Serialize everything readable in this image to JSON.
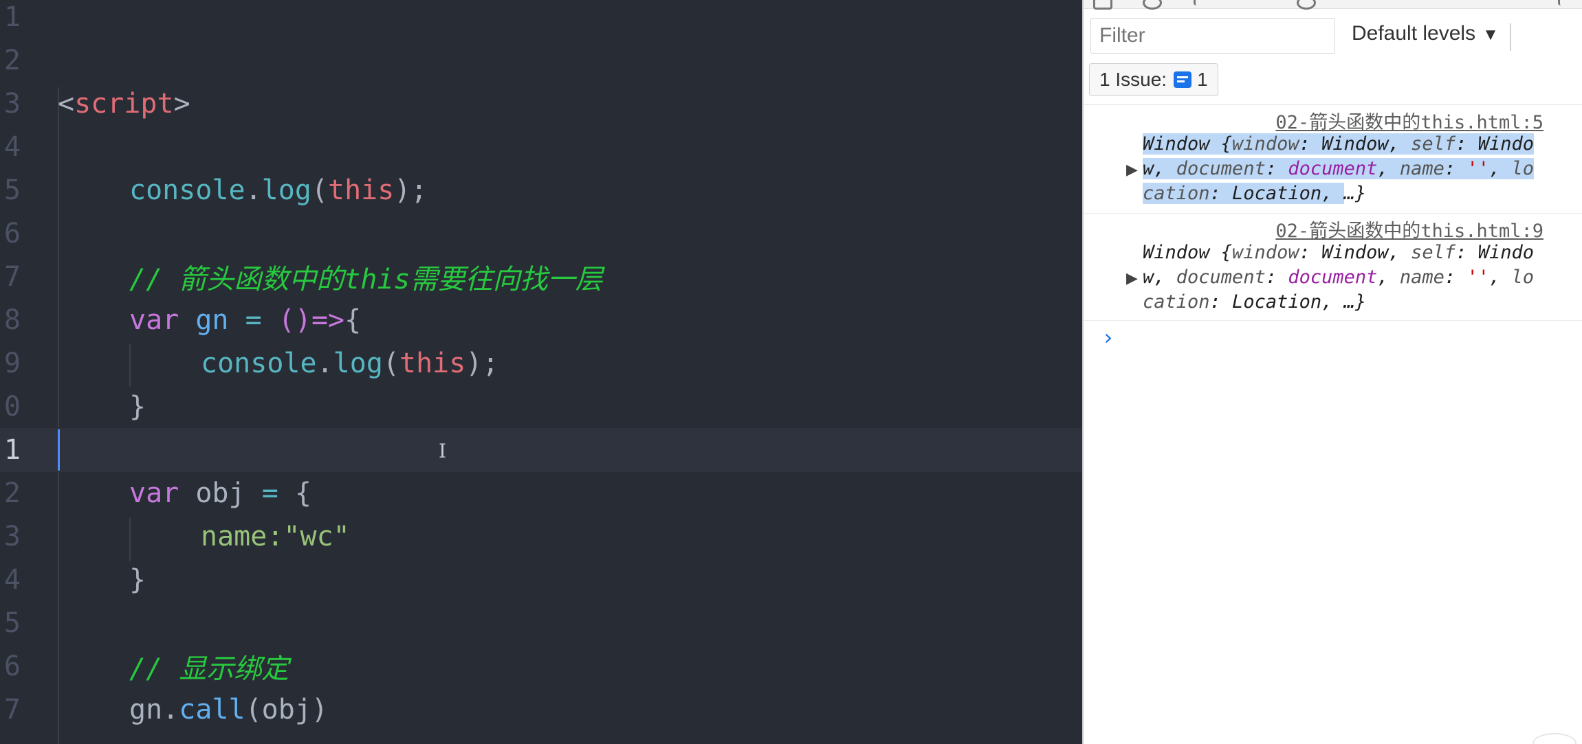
{
  "editor": {
    "lines": [
      {
        "num": "1"
      },
      {
        "num": "2"
      },
      {
        "num": "3",
        "tokens": {
          "open": "<",
          "tag": "script",
          "close": ">"
        }
      },
      {
        "num": "4"
      },
      {
        "num": "5",
        "tokens": {
          "obj": "console",
          "dot": ".",
          "fn": "log",
          "lp": "(",
          "kw": "this",
          "rp": ");"
        }
      },
      {
        "num": "6"
      },
      {
        "num": "7",
        "tokens": {
          "slashes": "// ",
          "text_a": "箭头函数中的",
          "text_b": "this",
          "text_c": "需要往向找一层"
        }
      },
      {
        "num": "8",
        "tokens": {
          "kw": "var",
          "name": "gn",
          "eq": "=",
          "arrow": "()=>",
          "brace": "{"
        }
      },
      {
        "num": "9",
        "tokens": {
          "obj": "console",
          "dot": ".",
          "fn": "log",
          "lp": "(",
          "kw": "this",
          "rp": ");"
        }
      },
      {
        "num": "0",
        "tokens": {
          "brace": "}"
        }
      },
      {
        "num": "1"
      },
      {
        "num": "2",
        "tokens": {
          "kw": "var",
          "name": "obj",
          "eq": "=",
          "brace": "{"
        }
      },
      {
        "num": "3",
        "tokens": {
          "prop": "name:",
          "str": "\"wc\""
        }
      },
      {
        "num": "4",
        "tokens": {
          "brace": "}"
        }
      },
      {
        "num": "5"
      },
      {
        "num": "6",
        "tokens": {
          "slashes": "// ",
          "text": "显示绑定"
        }
      },
      {
        "num": "7",
        "tokens": {
          "obj": "gn",
          "dot": ".",
          "fn": "call",
          "args": "(obj)"
        }
      }
    ],
    "cursor_glyph": "I"
  },
  "devtools": {
    "filter": {
      "placeholder": "Filter"
    },
    "levels": {
      "label": "Default levels",
      "caret": "▼"
    },
    "issues": {
      "label": "1 Issue:",
      "count": "1"
    },
    "logs": [
      {
        "source": "02-箭头函数中的this.html:5",
        "expand": "▶",
        "p1": "Window {",
        "p2": "window",
        "p3": ": Window, ",
        "p4": "self",
        "p5": ": Windo",
        "p6": "w, ",
        "p7": "document",
        "p8": ": ",
        "p9": "document",
        "p10": ", ",
        "p11": "name",
        "p12": ": ",
        "p13": "''",
        "p14": ", ",
        "p15": "loc",
        "p16": "ation",
        "p17": ": Location, ",
        "p18": "…}"
      },
      {
        "source": "02-箭头函数中的this.html:9",
        "expand": "▶",
        "p1": "Window {",
        "p2": "window",
        "p3": ": Window, ",
        "p4": "self",
        "p5": ": Windo",
        "p6": "w, ",
        "p7": "document",
        "p8": ": ",
        "p9": "document",
        "p10": ", ",
        "p11": "name",
        "p12": ": ",
        "p13": "''",
        "p14": ", ",
        "p15": "loc",
        "p16": "ation",
        "p17": ": Location, ",
        "p18": "…}"
      }
    ],
    "prompt": "›"
  }
}
